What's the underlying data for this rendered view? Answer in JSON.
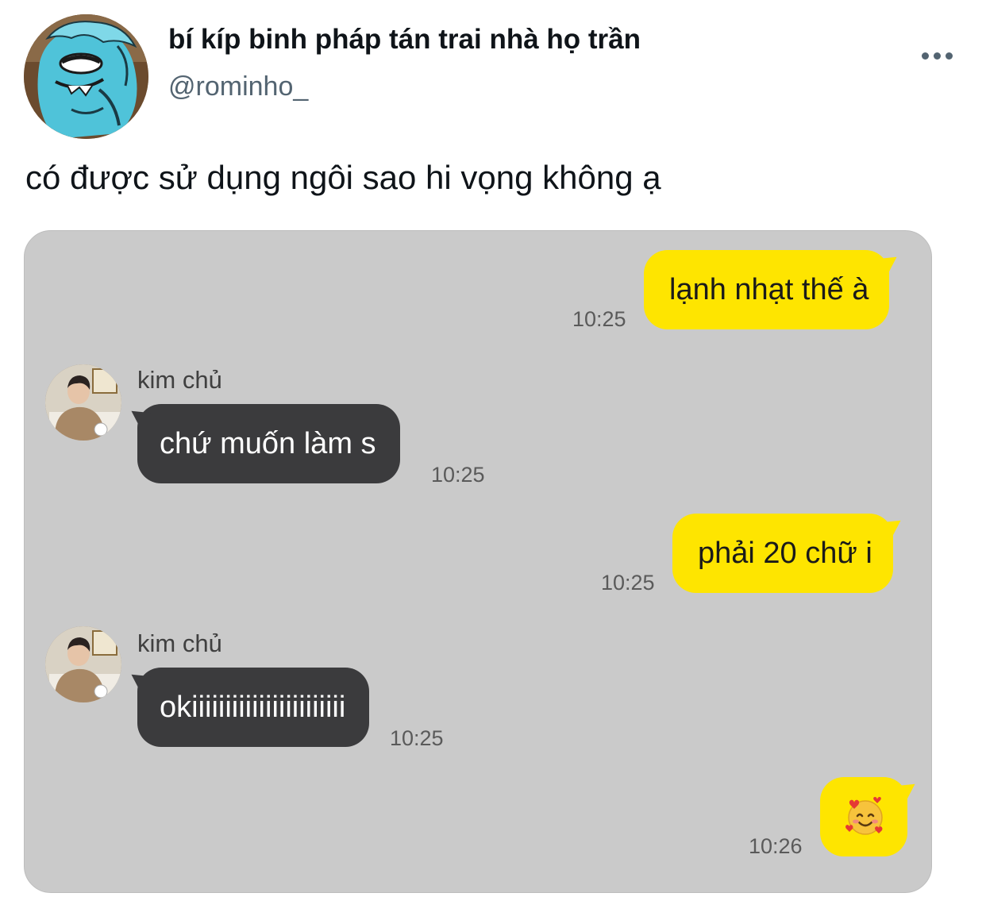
{
  "tweet": {
    "display_name": "bí kíp binh pháp tán trai nhà họ trần",
    "handle": "@rominho_",
    "text": "có được sử dụng ngôi sao hi vọng không ạ",
    "more_icon": "more-horizontal-icon"
  },
  "chat": {
    "background_color": "#cacaca",
    "outgoing_color": "#fee500",
    "incoming_color": "#3b3b3d",
    "messages": [
      {
        "direction": "out",
        "text": "lạnh nhạt thế à",
        "time": "10:25"
      },
      {
        "direction": "in",
        "sender": "kim chủ",
        "text": "chứ muốn làm s",
        "time": "10:25"
      },
      {
        "direction": "out",
        "text": "phải 20 chữ i",
        "time": "10:25"
      },
      {
        "direction": "in",
        "sender": "kim chủ",
        "text": "okiiiiiiiiiiiiiiiiiiiiiii",
        "time": "10:25"
      },
      {
        "direction": "out",
        "emoji": "smiling-face-with-hearts-emoji",
        "time": "10:26"
      }
    ]
  }
}
